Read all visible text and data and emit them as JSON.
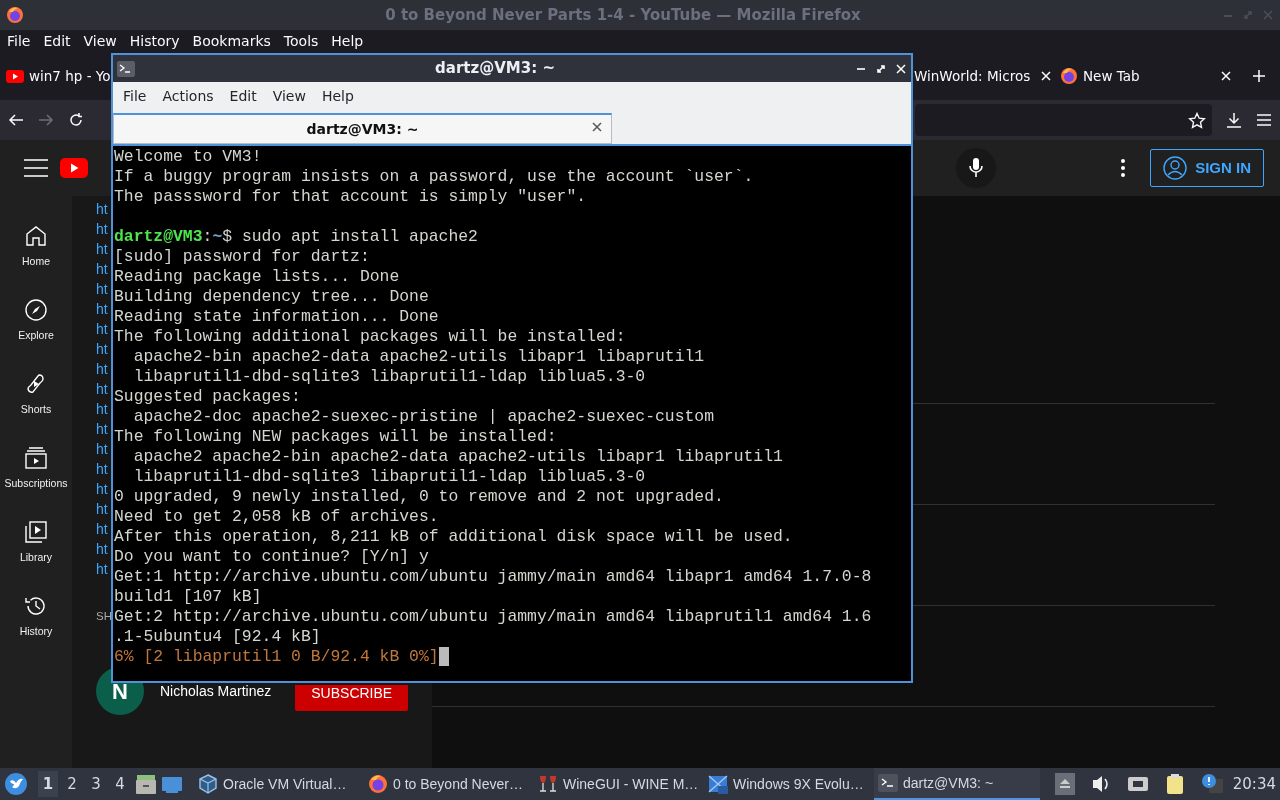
{
  "browser": {
    "title": "0 to Beyond Never Parts 1-4 - YouTube — Mozilla Firefox",
    "menu": [
      "File",
      "Edit",
      "View",
      "History",
      "Bookmarks",
      "Tools",
      "Help"
    ],
    "tabs": [
      {
        "label": "win7 hp - Yo",
        "selected": false
      },
      {
        "label": "WinWorld: Micros",
        "selected": false
      },
      {
        "label": "New Tab",
        "selected": false
      }
    ],
    "forward_enabled": false
  },
  "youtube": {
    "sign_in": "SIGN IN",
    "sidebar": [
      {
        "label": "Home"
      },
      {
        "label": "Explore"
      },
      {
        "label": "Shorts"
      },
      {
        "label": "Subscriptions"
      },
      {
        "label": "Library"
      },
      {
        "label": "History"
      }
    ],
    "links": [
      "ht",
      "ht",
      "ht",
      "ht",
      "ht",
      "ht",
      "ht",
      "ht",
      "ht",
      "ht",
      "ht",
      "ht",
      "ht",
      "ht",
      "ht",
      "ht",
      "ht",
      "ht",
      "ht"
    ],
    "section": "SH",
    "channel": {
      "initial": "N",
      "name": "Nicholas Martinez",
      "subscribe": "SUBSCRIBE"
    }
  },
  "terminal": {
    "title": "dartz@VM3: ~",
    "menu": [
      "File",
      "Actions",
      "Edit",
      "View",
      "Help"
    ],
    "tabs": [
      {
        "label": "dartz@VM3: ~",
        "selected": true
      }
    ],
    "lines": [
      {
        "kind": "text",
        "text": "Welcome to VM3!"
      },
      {
        "kind": "text",
        "text": "If a buggy program insists on a password, use the account `user`."
      },
      {
        "kind": "text",
        "text": "The passsword for that account is simply \"user\"."
      },
      {
        "kind": "blank"
      },
      {
        "kind": "prompt",
        "user": "dartz@VM3",
        "separator": ":",
        "path": "~",
        "symbol": "$",
        "command": "sudo apt install apache2"
      },
      {
        "kind": "text",
        "text": "[sudo] password for dartz:"
      },
      {
        "kind": "text",
        "text": "Reading package lists... Done"
      },
      {
        "kind": "text",
        "text": "Building dependency tree... Done"
      },
      {
        "kind": "text",
        "text": "Reading state information... Done"
      },
      {
        "kind": "text",
        "text": "The following additional packages will be installed:"
      },
      {
        "kind": "text",
        "text": "  apache2-bin apache2-data apache2-utils libapr1 libaprutil1"
      },
      {
        "kind": "text",
        "text": "  libaprutil1-dbd-sqlite3 libaprutil1-ldap liblua5.3-0"
      },
      {
        "kind": "text",
        "text": "Suggested packages:"
      },
      {
        "kind": "text",
        "text": "  apache2-doc apache2-suexec-pristine | apache2-suexec-custom"
      },
      {
        "kind": "text",
        "text": "The following NEW packages will be installed:"
      },
      {
        "kind": "text",
        "text": "  apache2 apache2-bin apache2-data apache2-utils libapr1 libaprutil1"
      },
      {
        "kind": "text",
        "text": "  libaprutil1-dbd-sqlite3 libaprutil1-ldap liblua5.3-0"
      },
      {
        "kind": "text",
        "text": "0 upgraded, 9 newly installed, 0 to remove and 2 not upgraded."
      },
      {
        "kind": "text",
        "text": "Need to get 2,058 kB of archives."
      },
      {
        "kind": "text",
        "text": "After this operation, 8,211 kB of additional disk space will be used."
      },
      {
        "kind": "text",
        "text": "Do you want to continue? [Y/n] y"
      },
      {
        "kind": "text",
        "text": "Get:1 http://archive.ubuntu.com/ubuntu jammy/main amd64 libapr1 amd64 1.7.0-8"
      },
      {
        "kind": "text",
        "text": "build1 [107 kB]"
      },
      {
        "kind": "text",
        "text": "Get:2 http://archive.ubuntu.com/ubuntu jammy/main amd64 libaprutil1 amd64 1.6"
      },
      {
        "kind": "text",
        "text": ".1-5ubuntu4 [92.4 kB]"
      },
      {
        "kind": "progress",
        "text": "6% [2 libaprutil1 0 B/92.4 kB 0%]",
        "cursor": true
      }
    ]
  },
  "taskbar": {
    "workspaces": [
      {
        "label": "1",
        "selected": true
      },
      {
        "label": "2",
        "selected": false
      },
      {
        "label": "3",
        "selected": false
      },
      {
        "label": "4",
        "selected": false
      }
    ],
    "tasks": [
      {
        "label": "Oracle VM Virtual…",
        "selected": false
      },
      {
        "label": "0 to Beyond Never…",
        "selected": false
      },
      {
        "label": "WineGUI - WINE M…",
        "selected": false
      },
      {
        "label": "Windows 9X Evolu…",
        "selected": false
      },
      {
        "label": "dartz@VM3: ~",
        "selected": true
      }
    ],
    "clock": "20:34"
  }
}
